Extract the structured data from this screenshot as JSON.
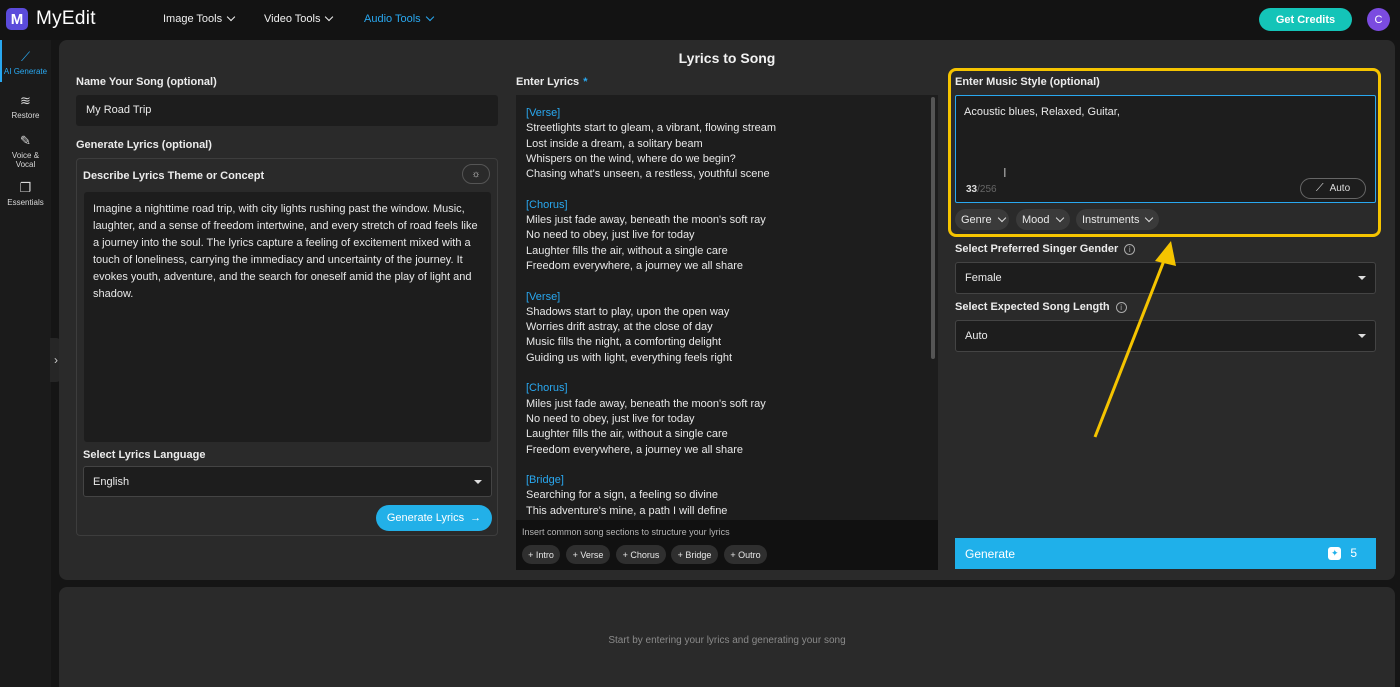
{
  "app": {
    "name": "MyEdit",
    "logo_letter": "M"
  },
  "nav": {
    "image_tools": "Image Tools",
    "video_tools": "Video Tools",
    "audio_tools": "Audio Tools"
  },
  "header": {
    "credits_button": "Get Credits",
    "avatar_letter": "C"
  },
  "sidebar": {
    "items": [
      {
        "label": "AI Generate",
        "icon": "magic-wand-icon",
        "active": true
      },
      {
        "label": "Restore",
        "icon": "waveform-icon"
      },
      {
        "label": "Voice & Vocal",
        "icon": "voice-wand-icon"
      },
      {
        "label": "Essentials",
        "icon": "layers-icon"
      }
    ]
  },
  "page": {
    "title": "Lyrics to Song"
  },
  "song_name": {
    "label": "Name Your Song (optional)",
    "value": "My Road Trip"
  },
  "generate_lyrics": {
    "label": "Generate Lyrics (optional)",
    "theme_label": "Describe Lyrics Theme or Concept",
    "theme_text": "Imagine a nighttime road trip, with city lights rushing past the window. Music, laughter, and a sense of freedom intertwine, and every stretch of road feels like a journey into the soul. The lyrics capture a feeling of excitement mixed with a touch of loneliness, carrying the immediacy and uncertainty of the journey. It evokes youth, adventure, and the search for oneself amid the play of light and shadow.",
    "language_label": "Select Lyrics Language",
    "language_value": "English",
    "button": "Generate Lyrics"
  },
  "lyrics": {
    "label": "Enter Lyrics",
    "required_mark": "*",
    "stanzas": [
      {
        "section": "[Verse]",
        "lines": [
          "Streetlights start to gleam, a vibrant, flowing stream",
          "Lost inside a dream, a solitary beam",
          "Whispers on the wind, where do we begin?",
          "Chasing what's unseen, a restless, youthful scene"
        ]
      },
      {
        "section": "[Chorus]",
        "lines": [
          "Miles just fade away, beneath the moon's soft ray",
          "No need to obey, just live for today",
          "Laughter fills the air, without a single care",
          "Freedom everywhere, a journey we all share"
        ]
      },
      {
        "section": "[Verse]",
        "lines": [
          "Shadows start to play, upon the open way",
          "Worries drift astray, at the close of day",
          "Music fills the night, a comforting delight",
          "Guiding us with light, everything feels right"
        ]
      },
      {
        "section": "[Chorus]",
        "lines": [
          "Miles just fade away, beneath the moon's soft ray",
          "No need to obey, just live for today",
          "Laughter fills the air, without a single care",
          "Freedom everywhere, a journey we all share"
        ]
      },
      {
        "section": "[Bridge]",
        "lines": [
          "Searching for a sign, a feeling so divine",
          "This adventure's mine, a path I will define"
        ]
      }
    ],
    "sections_hint": "Insert common song sections to structure your lyrics",
    "section_chips": [
      "+ Intro",
      "+ Verse",
      "+ Chorus",
      "+ Bridge",
      "+ Outro"
    ]
  },
  "music_style": {
    "label": "Enter Music Style (optional)",
    "value": "Acoustic blues, Relaxed, Guitar,",
    "count": "33",
    "max": "/256",
    "auto_button": "Auto",
    "tags": [
      "Genre",
      "Mood",
      "Instruments"
    ]
  },
  "singer_gender": {
    "label": "Select Preferred Singer Gender",
    "value": "Female"
  },
  "song_length": {
    "label": "Select Expected Song Length",
    "value": "Auto"
  },
  "generate": {
    "label": "Generate",
    "cost": "5"
  },
  "result": {
    "placeholder": "Start by entering your lyrics and generating your song"
  },
  "colors": {
    "accent": "#29a8f0",
    "highlight": "#f5c400",
    "credits": "#14c4b8"
  }
}
